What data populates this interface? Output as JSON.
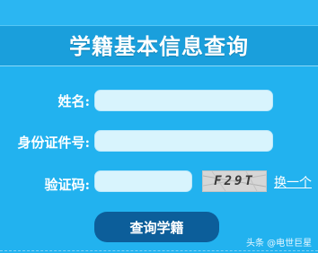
{
  "header": {
    "title": "学籍基本信息查询"
  },
  "form": {
    "name_label": "姓名:",
    "name_value": "",
    "id_label": "身份证件号:",
    "id_value": "",
    "captcha_label": "验证码:",
    "captcha_value": "",
    "captcha_image_text": "F29T",
    "refresh_link": "换一个"
  },
  "actions": {
    "query_button": "查询学籍"
  },
  "watermark": "头条 @电世巨星",
  "colors": {
    "background": "#22b2ef",
    "header": "#1a9fdc",
    "input": "#d8f4fd",
    "button": "#0c5e9a"
  }
}
